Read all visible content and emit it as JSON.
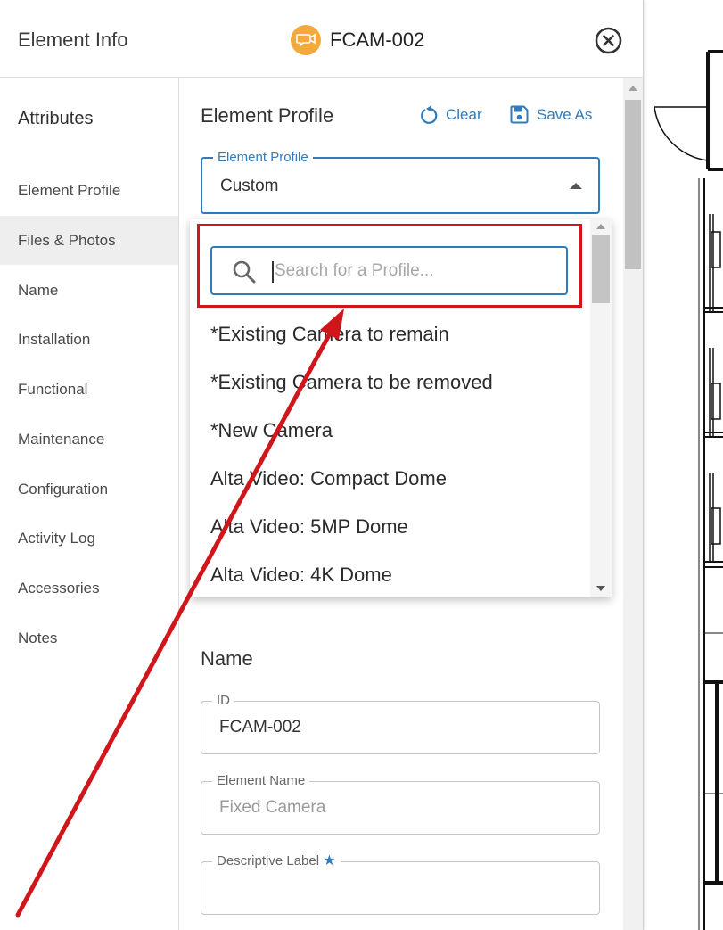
{
  "header": {
    "title": "Element Info",
    "element_id": "FCAM-002",
    "badge_icon": "camera-video-icon",
    "badge_color": "#F4A93C"
  },
  "sidebar": {
    "heading": "Attributes",
    "items": [
      {
        "label": "Element Profile"
      },
      {
        "label": "Files & Photos",
        "active": true
      },
      {
        "label": "Name"
      },
      {
        "label": "Installation"
      },
      {
        "label": "Functional"
      },
      {
        "label": "Maintenance"
      },
      {
        "label": "Configuration"
      },
      {
        "label": "Activity Log"
      },
      {
        "label": "Accessories"
      },
      {
        "label": "Notes"
      }
    ]
  },
  "profile_section": {
    "title": "Element Profile",
    "clear_label": "Clear",
    "save_as_label": "Save As",
    "select_label": "Element Profile",
    "select_value": "Custom"
  },
  "dropdown": {
    "search_placeholder": "Search for a Profile...",
    "search_value": "",
    "options": [
      "*Existing Camera to remain",
      "*Existing Camera to be removed",
      "*New Camera",
      "Alta Video: Compact Dome",
      "Alta Video: 5MP Dome",
      "Alta Video: 4K Dome"
    ]
  },
  "name_section": {
    "title": "Name",
    "id_label": "ID",
    "id_value": "FCAM-002",
    "element_name_label": "Element Name",
    "element_name_placeholder": "Fixed Camera",
    "descriptive_label_label": "Descriptive Label",
    "descriptive_label_value": ""
  },
  "colors": {
    "accent": "#2F7BBD",
    "annotation": "#D0161B"
  }
}
